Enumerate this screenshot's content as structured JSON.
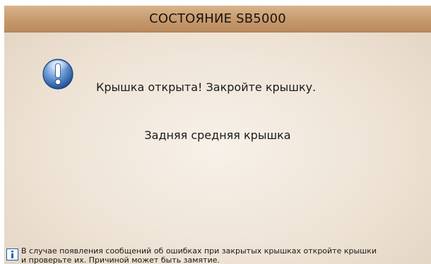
{
  "window": {
    "title": "СОСТОЯНИЕ SB5000"
  },
  "alert": {
    "icon": "exclamation-icon",
    "message": "Крышка открыта! Закройте крышку.",
    "detail": "Задняя средняя крышка"
  },
  "info": {
    "icon": "info-icon",
    "line1": "В случае появления сообщений об ошибках при закрытых крышках откройте крышки",
    "line2": "и проверьте их. Причиной может быть замятие."
  },
  "colors": {
    "titlebar": "#c89c70",
    "background": "#efe5d8",
    "accent_blue": "#1f5fb0"
  }
}
